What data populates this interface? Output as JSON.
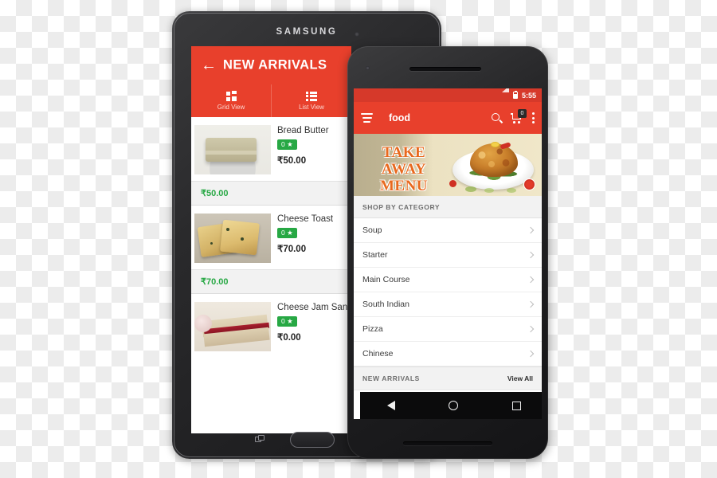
{
  "scene": {
    "description": "Two Android devices showing a food ordering app on transparency checkerboard"
  },
  "tablet": {
    "brand": "SAMSUNG",
    "appbar": {
      "back_icon": "arrow-left-icon",
      "title": "NEW ARRIVALS"
    },
    "tabs": [
      {
        "label": "Grid View",
        "icon": "grid-view-icon"
      },
      {
        "label": "List View",
        "icon": "list-view-icon"
      }
    ],
    "products": [
      {
        "name": "Bread Butter",
        "rating": "0 ★",
        "price": "₹50.00",
        "strip_price": "₹50.00"
      },
      {
        "name": "Cheese Toast",
        "rating": "0 ★",
        "price": "₹70.00",
        "strip_price": "₹70.00"
      },
      {
        "name": "Cheese Jam San",
        "rating": "0 ★",
        "price": "₹0.00",
        "strip_price": ""
      }
    ],
    "nav": {
      "recents_icon": "recents-icon",
      "home_button": "home-button"
    }
  },
  "phone": {
    "status": {
      "time": "5:55",
      "signal_icon": "signal-icon",
      "battery_icon": "battery-icon"
    },
    "appbar": {
      "menu_icon": "hamburger-menu-icon",
      "brand": "food",
      "search_icon": "search-icon",
      "cart_icon": "cart-icon",
      "cart_count": "0",
      "overflow_icon": "overflow-menu-icon"
    },
    "banner": {
      "line1": "TAKE AWAY",
      "line2": "MENU",
      "image": "biryani-plate-image"
    },
    "section_title": "SHOP BY CATEGORY",
    "categories": [
      {
        "label": "Soup"
      },
      {
        "label": "Starter"
      },
      {
        "label": "Main Course"
      },
      {
        "label": "South Indian"
      },
      {
        "label": "Pizza"
      },
      {
        "label": "Chinese"
      }
    ],
    "footer": {
      "title": "NEW ARRIVALS",
      "action": "View All"
    },
    "nav": {
      "back_icon": "nav-back-icon",
      "home_icon": "nav-home-icon",
      "recents_icon": "nav-recents-icon"
    }
  },
  "colors": {
    "primary_red": "#e8402c",
    "status_red": "#d6392a",
    "rating_green": "#27a844",
    "price_green": "#27a844",
    "banner_orange": "#e8691e"
  }
}
